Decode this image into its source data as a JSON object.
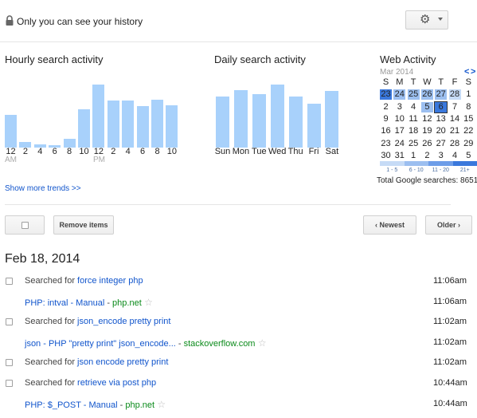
{
  "header": {
    "privacy_text": "Only you can see your history"
  },
  "hourly": {
    "title": "Hourly search activity",
    "ticks": [
      "12",
      "2",
      "4",
      "6",
      "8",
      "10",
      "12",
      "2",
      "4",
      "6",
      "8",
      "10"
    ],
    "am": "AM",
    "pm": "PM",
    "values": [
      41,
      7,
      4,
      3,
      11,
      48,
      79,
      59,
      59,
      52,
      60,
      53
    ]
  },
  "daily": {
    "title": "Daily search activity",
    "days": [
      "Sun",
      "Mon",
      "Tue",
      "Wed",
      "Thu",
      "Fri",
      "Sat"
    ],
    "values": [
      64,
      72,
      67,
      79,
      64,
      55,
      71
    ]
  },
  "web_activity": {
    "title": "Web Activity",
    "month": "Mar 2014",
    "prev": "<",
    "next": ">",
    "weekdays": [
      "S",
      "M",
      "T",
      "W",
      "T",
      "F",
      "S"
    ],
    "weeks": [
      [
        "23",
        "24",
        "25",
        "26",
        "27",
        "28",
        "1"
      ],
      [
        "2",
        "3",
        "4",
        "5",
        "6",
        "7",
        "8"
      ],
      [
        "9",
        "10",
        "11",
        "12",
        "13",
        "14",
        "15"
      ],
      [
        "16",
        "17",
        "18",
        "19",
        "20",
        "21",
        "22"
      ],
      [
        "23",
        "24",
        "25",
        "26",
        "27",
        "28",
        "29"
      ],
      [
        "30",
        "31",
        "1",
        "2",
        "3",
        "4",
        "5"
      ]
    ],
    "legend": [
      "1 - 5",
      "6 - 10",
      "11 - 20",
      "21+"
    ],
    "total": "Total Google searches: 8651"
  },
  "links": {
    "show_more": "Show more trends >>"
  },
  "toolbar": {
    "remove": "Remove items",
    "newest": "Newest",
    "older": "Older"
  },
  "date_heading": "Feb 18, 2014",
  "history": [
    {
      "prefix": "Searched for ",
      "query": "force integer php",
      "time": "11:06am",
      "type": "search"
    },
    {
      "title": "PHP: intval - Manual",
      "sep": " - ",
      "domain": "php.net",
      "time": "11:06am",
      "type": "page"
    },
    {
      "prefix": "Searched for ",
      "query": "json_encode pretty print",
      "time": "11:02am",
      "type": "search"
    },
    {
      "title": "json - PHP \"pretty print\" json_encode...",
      "sep": " - ",
      "domain": "stackoverflow.com",
      "time": "11:02am",
      "type": "page"
    },
    {
      "prefix": "Searched for ",
      "query": "json encode pretty print",
      "time": "11:02am",
      "type": "search"
    },
    {
      "prefix": "Searched for ",
      "query": "retrieve via post php",
      "time": "10:44am",
      "type": "search"
    },
    {
      "title": "PHP: $_POST - Manual",
      "sep": " - ",
      "domain": "php.net",
      "time": "10:44am",
      "type": "page"
    }
  ],
  "colors": {
    "bar": "#a8d1fb",
    "link": "#1155cc",
    "domain": "#0a8a1a"
  },
  "icons": {
    "lock": "lock-icon",
    "gear": "gear-icon",
    "star": "star-icon"
  }
}
